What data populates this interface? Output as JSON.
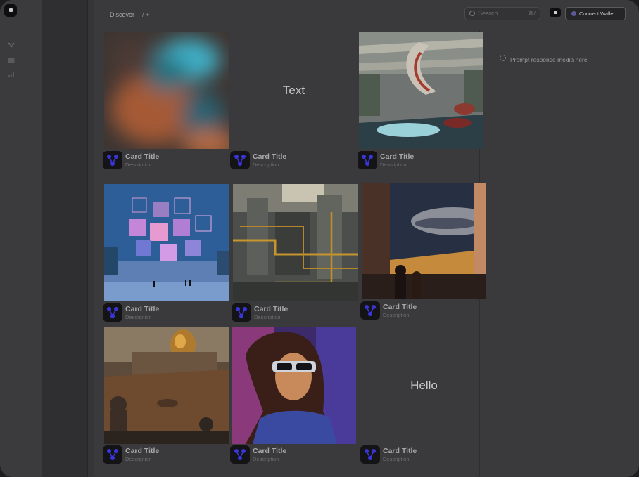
{
  "header": {
    "breadcrumb": "Discover",
    "breadcrumb_add": "/ +",
    "search_placeholder": "Search",
    "search_shortcut": "⌘/",
    "connect_wallet": "Connect Wallet"
  },
  "response_panel": {
    "placeholder": "Prompt response media here"
  },
  "cards": [
    {
      "title": "Card Title",
      "description": "Description",
      "image": "blurred abstract teal and orange",
      "text": ""
    },
    {
      "title": "Card Title",
      "description": "Description",
      "image": "",
      "text": "Text"
    },
    {
      "title": "Card Title",
      "description": "Description",
      "image": "futuristic mall interior with spiral",
      "text": ""
    },
    {
      "title": "Card Title",
      "description": "Description",
      "image": "pink glass cubes city over water",
      "text": ""
    },
    {
      "title": "Card Title",
      "description": "Description",
      "image": "industrial machinery with yellow pipes",
      "text": ""
    },
    {
      "title": "Card Title",
      "description": "Description",
      "image": "people watching spaceships through window",
      "text": ""
    },
    {
      "title": "Card Title",
      "description": "Description",
      "image": "desert city with golden dome",
      "text": ""
    },
    {
      "title": "Card Title",
      "description": "Description",
      "image": "woman with cyber goggles portrait",
      "text": ""
    },
    {
      "title": "Card Title",
      "description": "Description",
      "image": "",
      "text": "Hello"
    }
  ],
  "colors": {
    "app_background": "#3a3a3c",
    "sidebar": "#3b3b3e",
    "accent": "#5d5a9a",
    "avatar_glyph": "#3a35d8"
  }
}
